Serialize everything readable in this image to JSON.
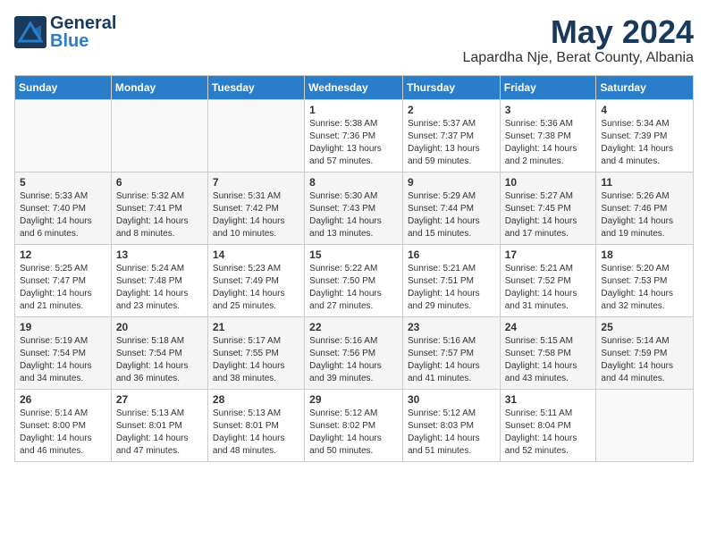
{
  "logo": {
    "general": "General",
    "blue": "Blue"
  },
  "header": {
    "month_year": "May 2024",
    "location": "Lapardha Nje, Berat County, Albania"
  },
  "days_of_week": [
    "Sunday",
    "Monday",
    "Tuesday",
    "Wednesday",
    "Thursday",
    "Friday",
    "Saturday"
  ],
  "weeks": [
    [
      {
        "day": "",
        "sunrise": "",
        "sunset": "",
        "daylight": ""
      },
      {
        "day": "",
        "sunrise": "",
        "sunset": "",
        "daylight": ""
      },
      {
        "day": "",
        "sunrise": "",
        "sunset": "",
        "daylight": ""
      },
      {
        "day": "1",
        "sunrise": "Sunrise: 5:38 AM",
        "sunset": "Sunset: 7:36 PM",
        "daylight": "Daylight: 13 hours and 57 minutes."
      },
      {
        "day": "2",
        "sunrise": "Sunrise: 5:37 AM",
        "sunset": "Sunset: 7:37 PM",
        "daylight": "Daylight: 13 hours and 59 minutes."
      },
      {
        "day": "3",
        "sunrise": "Sunrise: 5:36 AM",
        "sunset": "Sunset: 7:38 PM",
        "daylight": "Daylight: 14 hours and 2 minutes."
      },
      {
        "day": "4",
        "sunrise": "Sunrise: 5:34 AM",
        "sunset": "Sunset: 7:39 PM",
        "daylight": "Daylight: 14 hours and 4 minutes."
      }
    ],
    [
      {
        "day": "5",
        "sunrise": "Sunrise: 5:33 AM",
        "sunset": "Sunset: 7:40 PM",
        "daylight": "Daylight: 14 hours and 6 minutes."
      },
      {
        "day": "6",
        "sunrise": "Sunrise: 5:32 AM",
        "sunset": "Sunset: 7:41 PM",
        "daylight": "Daylight: 14 hours and 8 minutes."
      },
      {
        "day": "7",
        "sunrise": "Sunrise: 5:31 AM",
        "sunset": "Sunset: 7:42 PM",
        "daylight": "Daylight: 14 hours and 10 minutes."
      },
      {
        "day": "8",
        "sunrise": "Sunrise: 5:30 AM",
        "sunset": "Sunset: 7:43 PM",
        "daylight": "Daylight: 14 hours and 13 minutes."
      },
      {
        "day": "9",
        "sunrise": "Sunrise: 5:29 AM",
        "sunset": "Sunset: 7:44 PM",
        "daylight": "Daylight: 14 hours and 15 minutes."
      },
      {
        "day": "10",
        "sunrise": "Sunrise: 5:27 AM",
        "sunset": "Sunset: 7:45 PM",
        "daylight": "Daylight: 14 hours and 17 minutes."
      },
      {
        "day": "11",
        "sunrise": "Sunrise: 5:26 AM",
        "sunset": "Sunset: 7:46 PM",
        "daylight": "Daylight: 14 hours and 19 minutes."
      }
    ],
    [
      {
        "day": "12",
        "sunrise": "Sunrise: 5:25 AM",
        "sunset": "Sunset: 7:47 PM",
        "daylight": "Daylight: 14 hours and 21 minutes."
      },
      {
        "day": "13",
        "sunrise": "Sunrise: 5:24 AM",
        "sunset": "Sunset: 7:48 PM",
        "daylight": "Daylight: 14 hours and 23 minutes."
      },
      {
        "day": "14",
        "sunrise": "Sunrise: 5:23 AM",
        "sunset": "Sunset: 7:49 PM",
        "daylight": "Daylight: 14 hours and 25 minutes."
      },
      {
        "day": "15",
        "sunrise": "Sunrise: 5:22 AM",
        "sunset": "Sunset: 7:50 PM",
        "daylight": "Daylight: 14 hours and 27 minutes."
      },
      {
        "day": "16",
        "sunrise": "Sunrise: 5:21 AM",
        "sunset": "Sunset: 7:51 PM",
        "daylight": "Daylight: 14 hours and 29 minutes."
      },
      {
        "day": "17",
        "sunrise": "Sunrise: 5:21 AM",
        "sunset": "Sunset: 7:52 PM",
        "daylight": "Daylight: 14 hours and 31 minutes."
      },
      {
        "day": "18",
        "sunrise": "Sunrise: 5:20 AM",
        "sunset": "Sunset: 7:53 PM",
        "daylight": "Daylight: 14 hours and 32 minutes."
      }
    ],
    [
      {
        "day": "19",
        "sunrise": "Sunrise: 5:19 AM",
        "sunset": "Sunset: 7:54 PM",
        "daylight": "Daylight: 14 hours and 34 minutes."
      },
      {
        "day": "20",
        "sunrise": "Sunrise: 5:18 AM",
        "sunset": "Sunset: 7:54 PM",
        "daylight": "Daylight: 14 hours and 36 minutes."
      },
      {
        "day": "21",
        "sunrise": "Sunrise: 5:17 AM",
        "sunset": "Sunset: 7:55 PM",
        "daylight": "Daylight: 14 hours and 38 minutes."
      },
      {
        "day": "22",
        "sunrise": "Sunrise: 5:16 AM",
        "sunset": "Sunset: 7:56 PM",
        "daylight": "Daylight: 14 hours and 39 minutes."
      },
      {
        "day": "23",
        "sunrise": "Sunrise: 5:16 AM",
        "sunset": "Sunset: 7:57 PM",
        "daylight": "Daylight: 14 hours and 41 minutes."
      },
      {
        "day": "24",
        "sunrise": "Sunrise: 5:15 AM",
        "sunset": "Sunset: 7:58 PM",
        "daylight": "Daylight: 14 hours and 43 minutes."
      },
      {
        "day": "25",
        "sunrise": "Sunrise: 5:14 AM",
        "sunset": "Sunset: 7:59 PM",
        "daylight": "Daylight: 14 hours and 44 minutes."
      }
    ],
    [
      {
        "day": "26",
        "sunrise": "Sunrise: 5:14 AM",
        "sunset": "Sunset: 8:00 PM",
        "daylight": "Daylight: 14 hours and 46 minutes."
      },
      {
        "day": "27",
        "sunrise": "Sunrise: 5:13 AM",
        "sunset": "Sunset: 8:01 PM",
        "daylight": "Daylight: 14 hours and 47 minutes."
      },
      {
        "day": "28",
        "sunrise": "Sunrise: 5:13 AM",
        "sunset": "Sunset: 8:01 PM",
        "daylight": "Daylight: 14 hours and 48 minutes."
      },
      {
        "day": "29",
        "sunrise": "Sunrise: 5:12 AM",
        "sunset": "Sunset: 8:02 PM",
        "daylight": "Daylight: 14 hours and 50 minutes."
      },
      {
        "day": "30",
        "sunrise": "Sunrise: 5:12 AM",
        "sunset": "Sunset: 8:03 PM",
        "daylight": "Daylight: 14 hours and 51 minutes."
      },
      {
        "day": "31",
        "sunrise": "Sunrise: 5:11 AM",
        "sunset": "Sunset: 8:04 PM",
        "daylight": "Daylight: 14 hours and 52 minutes."
      },
      {
        "day": "",
        "sunrise": "",
        "sunset": "",
        "daylight": ""
      }
    ]
  ]
}
